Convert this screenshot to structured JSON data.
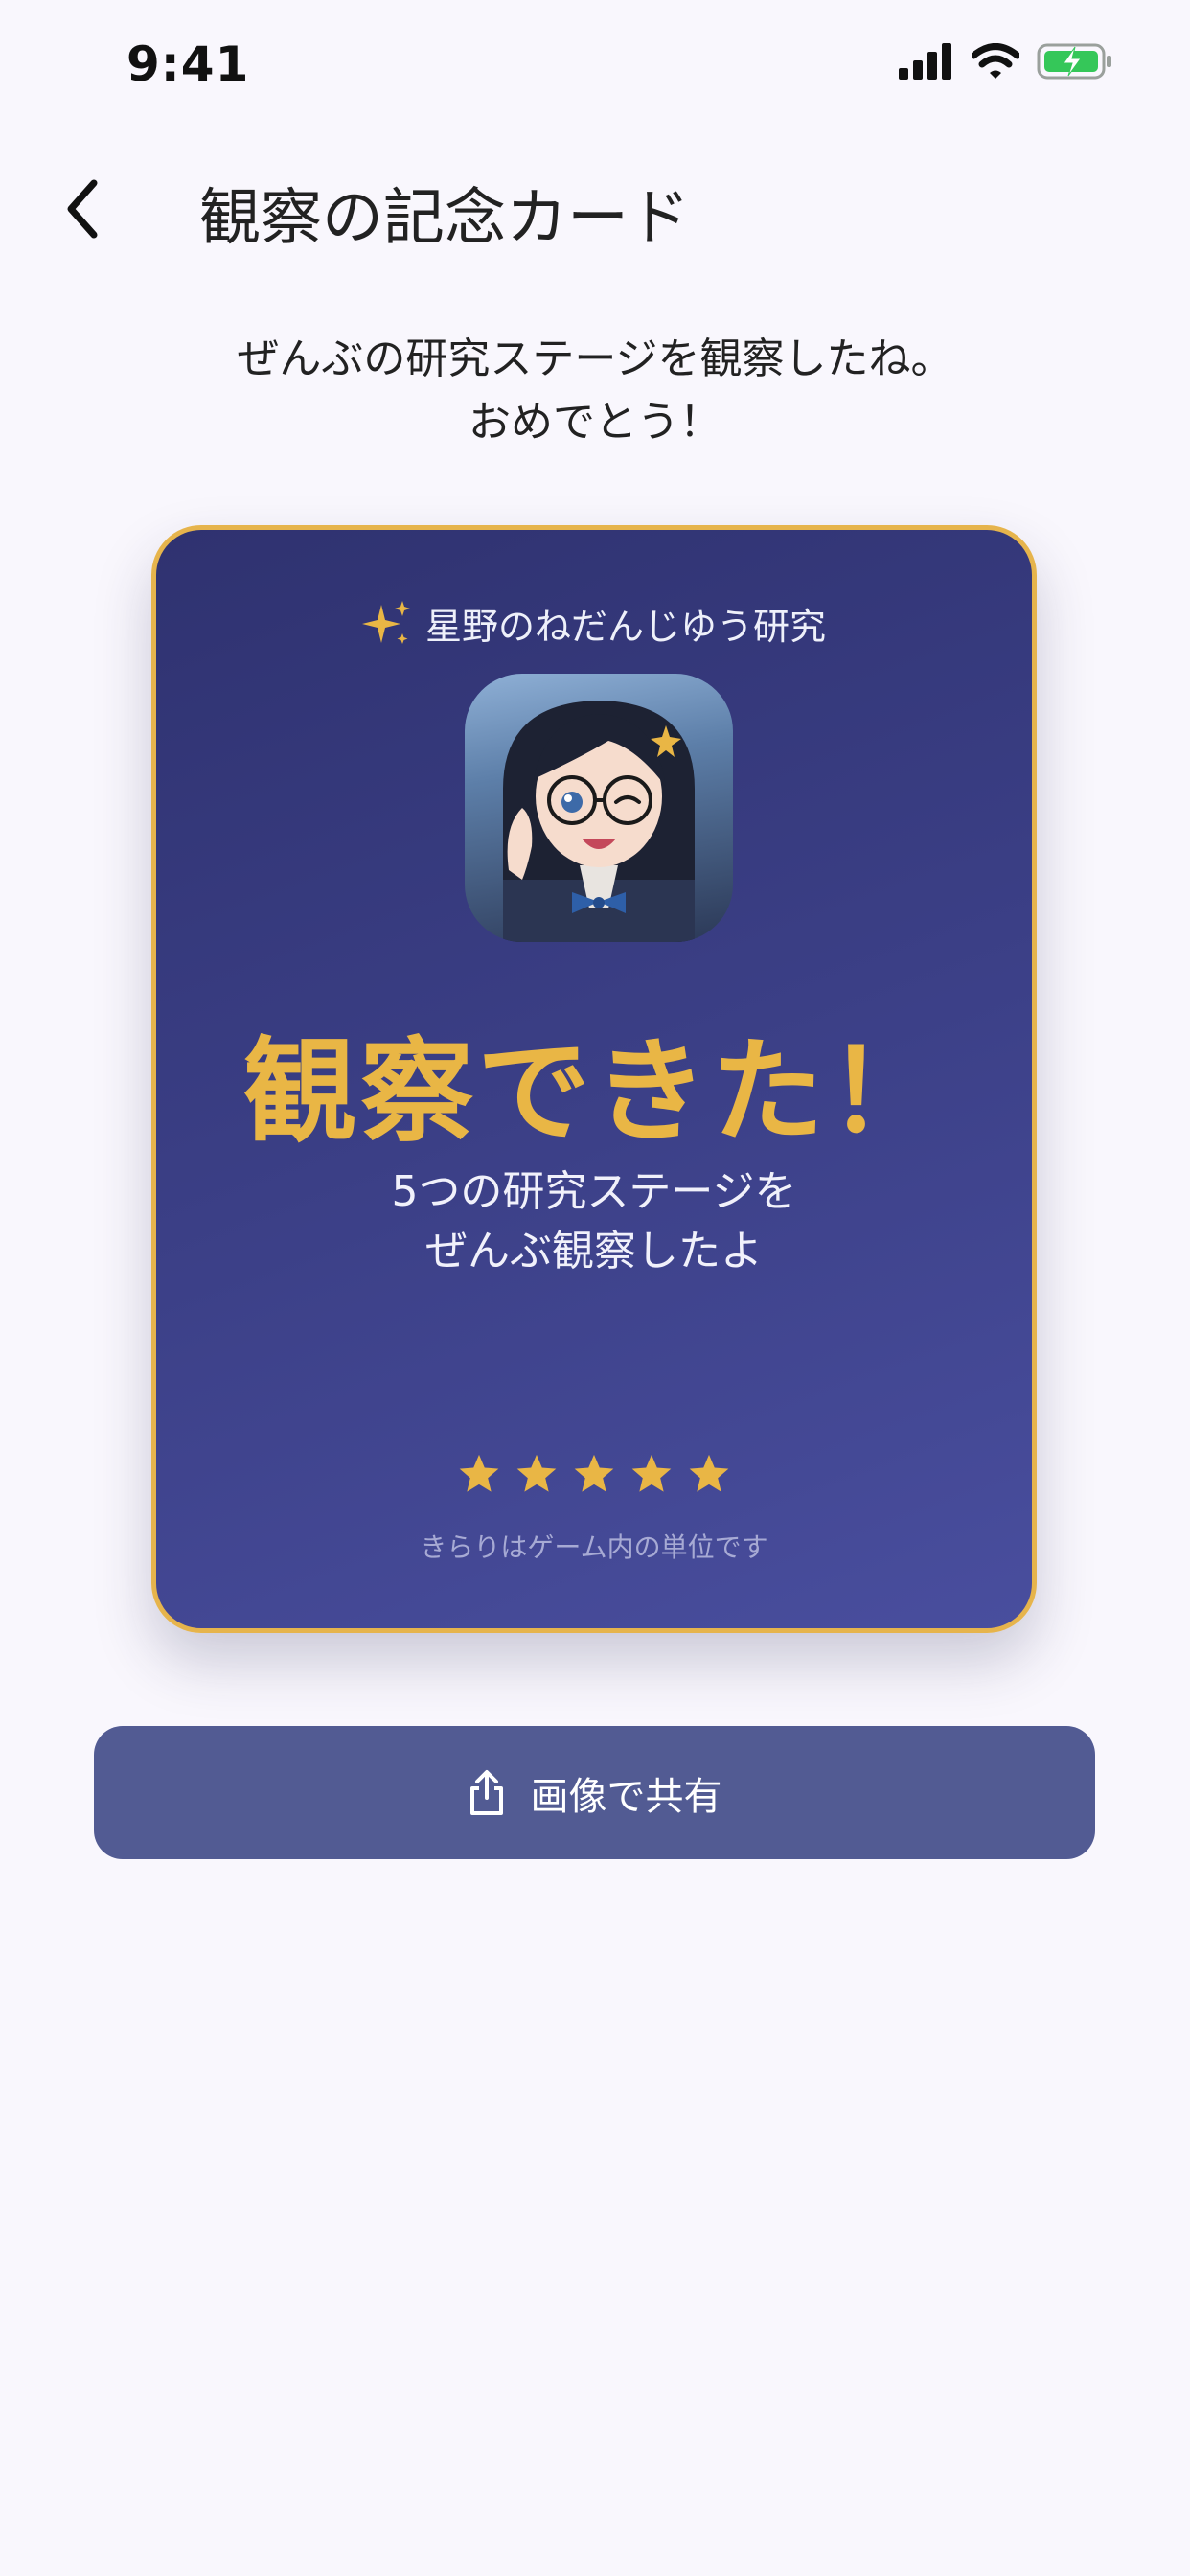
{
  "status_bar": {
    "time": "9:41"
  },
  "nav": {
    "title": "観察の記念カード"
  },
  "intro": {
    "line1": "ぜんぶの研究ステージを観察したね。",
    "line2": "おめでとう！"
  },
  "card": {
    "brand": "星野のねだんじゆう研究",
    "headline": "観察できた！",
    "sub_line1": "5つの研究ステージを",
    "sub_line2": "ぜんぶ観察したよ",
    "rating": {
      "stars": 5,
      "max": 5
    },
    "note": "きらりはゲーム内の単位です"
  },
  "share_button": {
    "label": "画像で共有",
    "icon": "share-icon"
  },
  "colors": {
    "accent": "#e9b645",
    "card_bg": "#3b3f86",
    "button": "#525b93",
    "page_bg": "#f9f7fd"
  }
}
